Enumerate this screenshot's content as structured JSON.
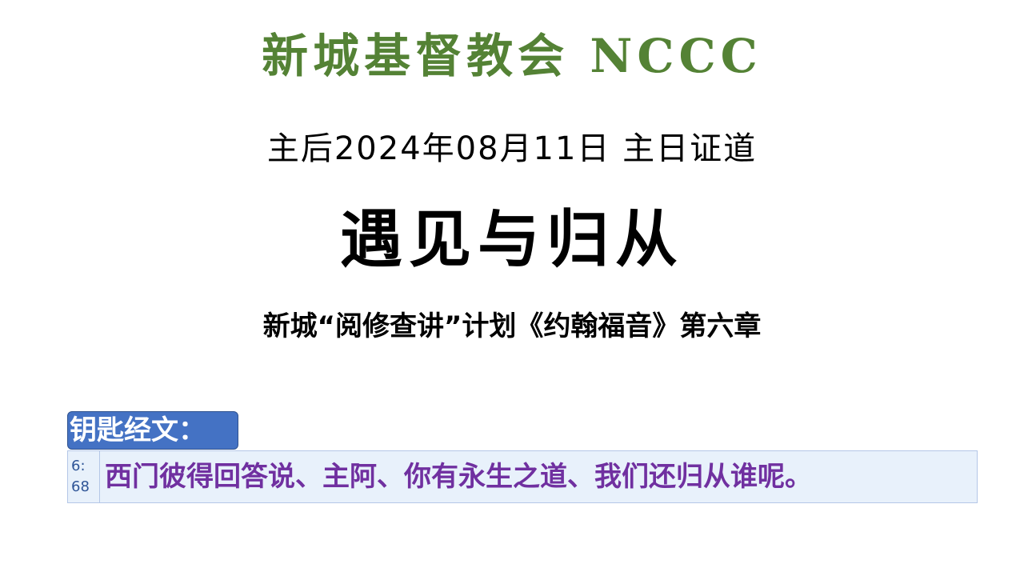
{
  "header": {
    "church_name": "新城基督教会 NCCC"
  },
  "date_line": "主后2024年08月11日 主日证道",
  "sermon_title": "遇见与归从",
  "series_line": "新城“阅修查讲”计划《约翰福音》第六章",
  "key_verse": {
    "label": "钥匙经文：",
    "ref_chapter": "6:",
    "ref_verse": "68",
    "text": "西门彼得回答说、主阿、你有永生之道、我们还归从谁呢。"
  },
  "colors": {
    "title_green": "#548235",
    "label_blue": "#4472c4",
    "verse_purple": "#7030a0",
    "row_background": "#e8f1fb"
  }
}
